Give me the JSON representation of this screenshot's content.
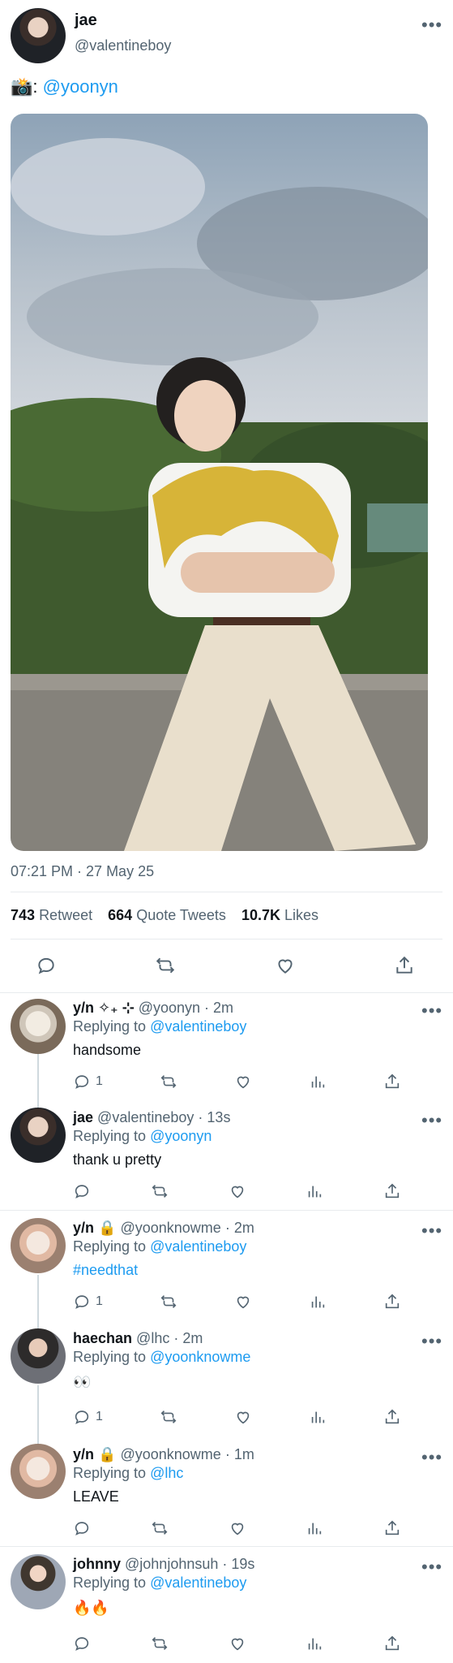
{
  "main_tweet": {
    "name": "jae",
    "handle": "@valentineboy",
    "more": "•••",
    "text_prefix": "📸:",
    "text_mention": "@yoonyn",
    "timestamp": "07:21 PM · 27 May 25",
    "stats": {
      "retweets_count": "743",
      "retweets_label": "Retweet",
      "quotes_count": "664",
      "quotes_label": "Quote Tweets",
      "likes_count": "10.7K",
      "likes_label": "Likes"
    }
  },
  "replies": [
    {
      "name": "y/n ✧₊ ⊹",
      "handle": "@yoonyn",
      "time": "· 2m",
      "replying_to_label": "Replying to",
      "replying_to": "@valentineboy",
      "text": "handsome",
      "reply_count": "1"
    },
    {
      "name": "jae",
      "handle": "@valentineboy",
      "time": "· 13s",
      "replying_to_label": "Replying to",
      "replying_to": "@yoonyn",
      "text": "thank u pretty",
      "reply_count": ""
    },
    {
      "name": "y/n",
      "handle": "@yoonknowme",
      "time": "· 2m",
      "replying_to_label": "Replying to",
      "replying_to": "@valentineboy",
      "text": "#needthat",
      "reply_count": "1"
    },
    {
      "name": "haechan",
      "handle": "@lhc",
      "time": "· 2m",
      "replying_to_label": "Replying to",
      "replying_to": "@yoonknowme",
      "text": "👀",
      "reply_count": "1"
    },
    {
      "name": "y/n",
      "handle": "@yoonknowme",
      "time": "· 1m",
      "replying_to_label": "Replying to",
      "replying_to": "@lhc",
      "text": "LEAVE",
      "reply_count": ""
    },
    {
      "name": "johnny",
      "handle": "@johnjohnsuh",
      "time": "· 19s",
      "replying_to_label": "Replying to",
      "replying_to": "@valentineboy",
      "text": "🔥🔥",
      "reply_count": ""
    }
  ],
  "icons": [
    "reply-icon",
    "retweet-icon",
    "like-icon",
    "analytics-icon",
    "share-icon",
    "lock-icon",
    "more-icon"
  ]
}
